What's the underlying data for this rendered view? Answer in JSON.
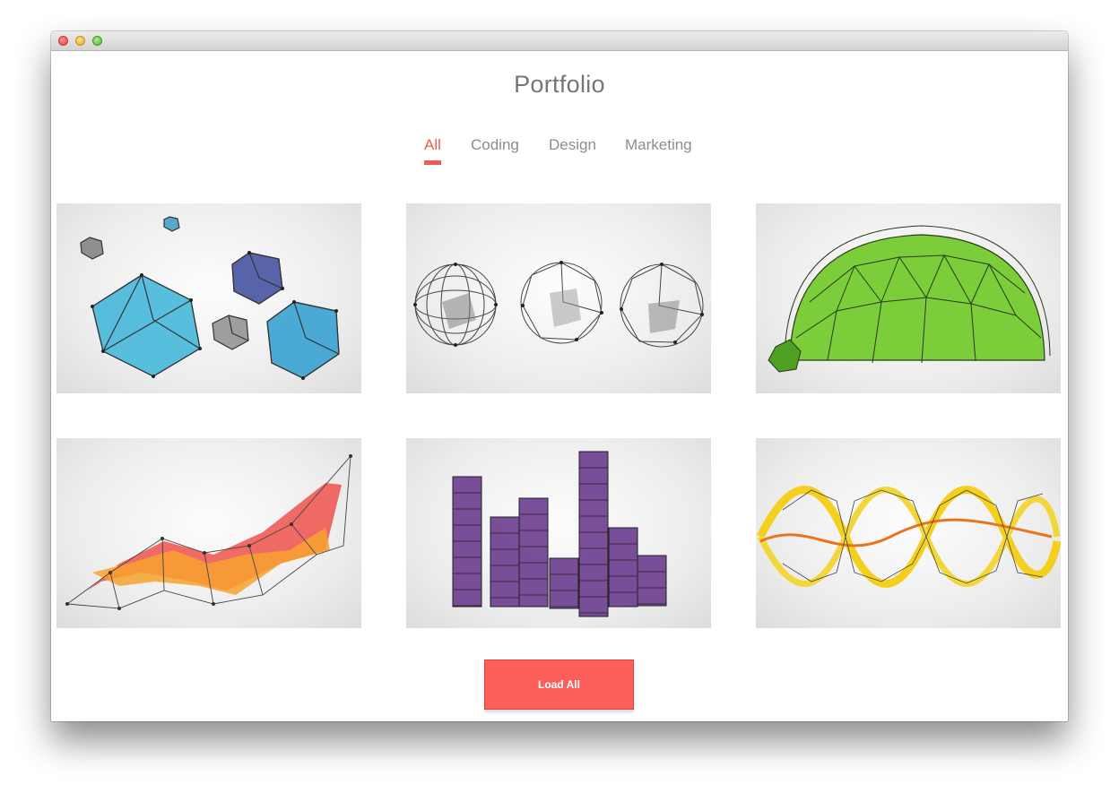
{
  "page": {
    "title": "Portfolio"
  },
  "tabs": [
    {
      "label": "All",
      "active": true
    },
    {
      "label": "Coding",
      "active": false
    },
    {
      "label": "Design",
      "active": false
    },
    {
      "label": "Marketing",
      "active": false
    }
  ],
  "load_button": {
    "label": "Load All"
  },
  "colors": {
    "accent": "#f05a55",
    "button": "#fb5f5a",
    "tab_inactive": "#8d8d8d",
    "title": "#767676"
  }
}
